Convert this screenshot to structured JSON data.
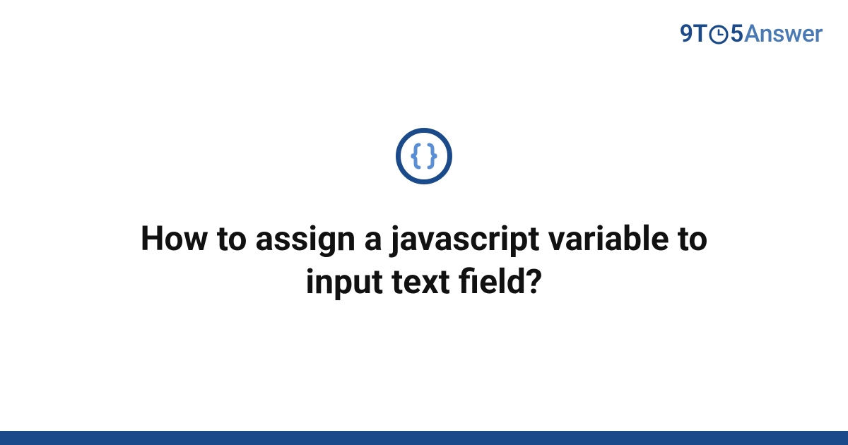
{
  "brand": {
    "nine": "9",
    "t": "T",
    "five": "5",
    "answer": "Answer"
  },
  "icons": {
    "center": "code-braces-icon",
    "logo_o": "clock-o-icon"
  },
  "main": {
    "title": "How to assign a javascript variable to input text field?"
  },
  "colors": {
    "brand_dark": "#1a4a8a",
    "brand_light": "#4a7ab5",
    "brace_fill": "#5a8fd6"
  }
}
